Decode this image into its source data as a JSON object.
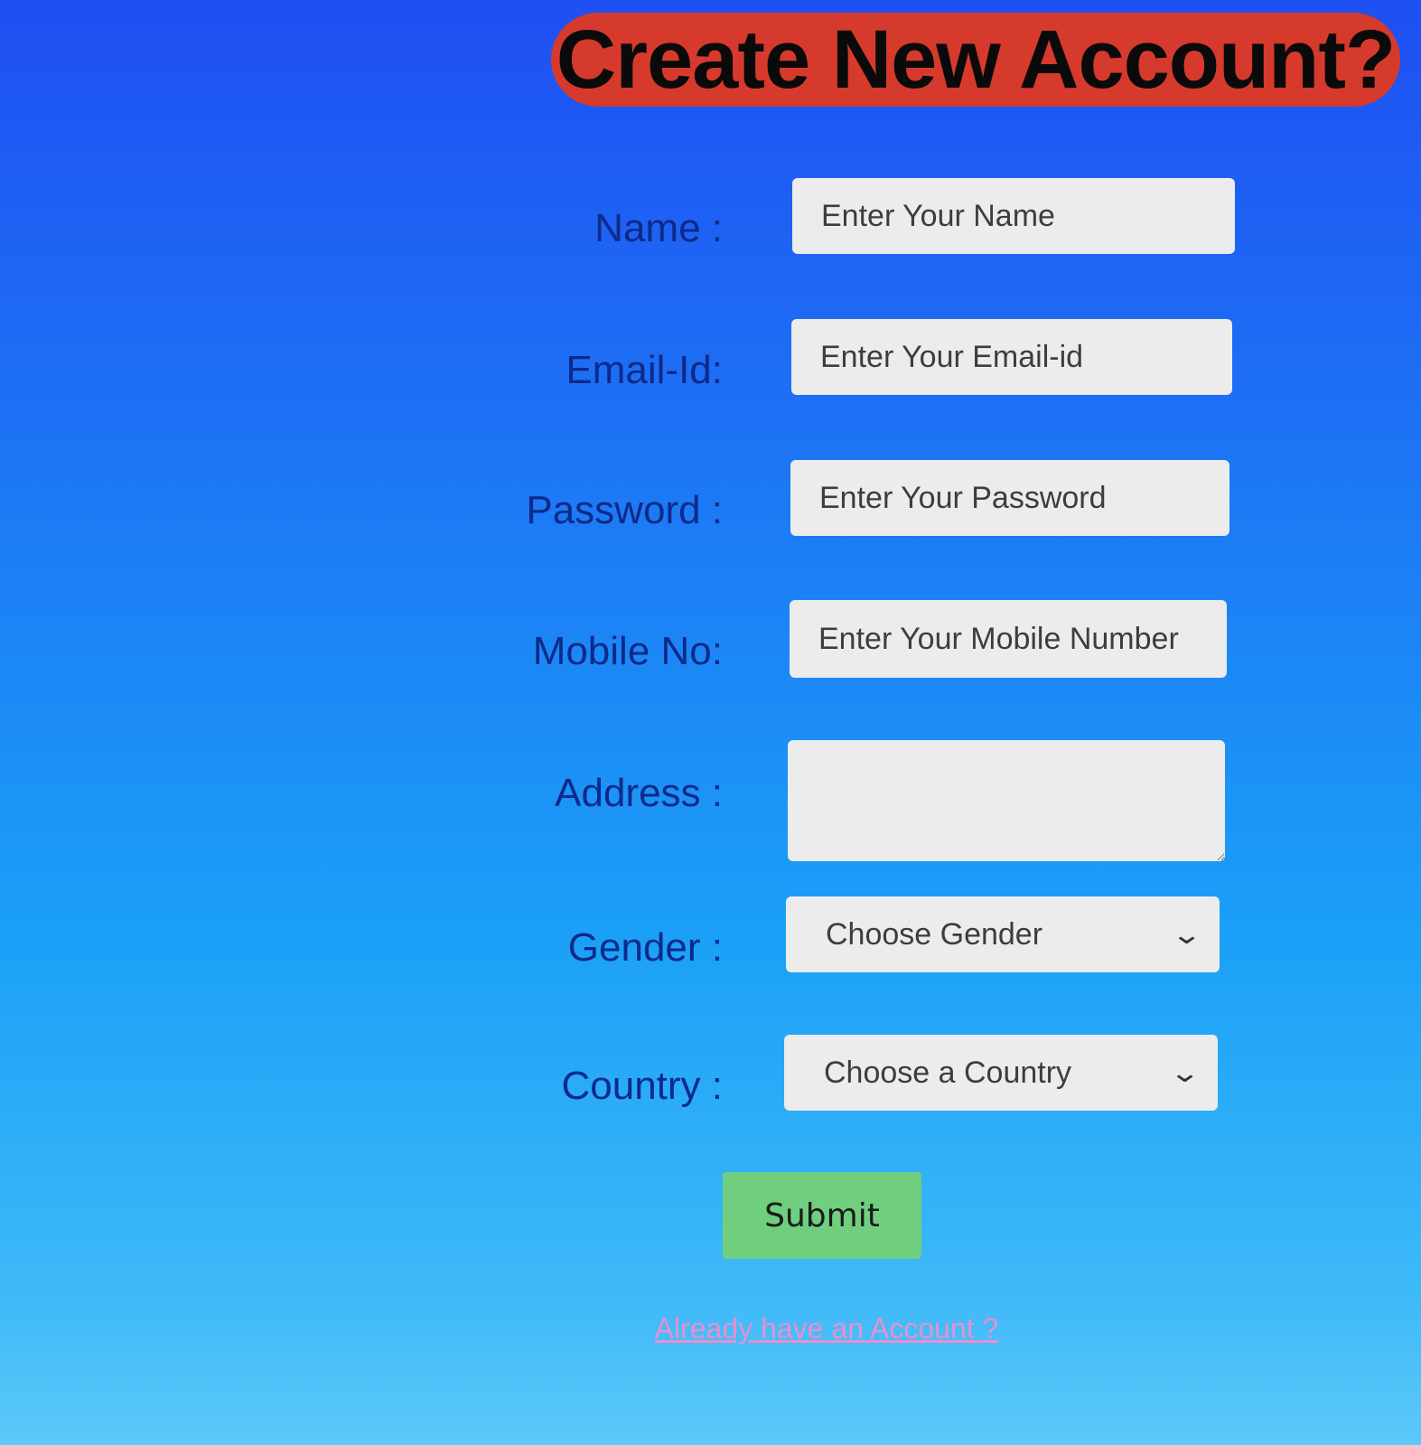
{
  "page": {
    "title": "Create New Account?"
  },
  "form": {
    "name": {
      "label": "Name :",
      "placeholder": "Enter Your Name"
    },
    "email": {
      "label": "Email-Id:",
      "placeholder": "Enter Your Email-id"
    },
    "password": {
      "label": "Password :",
      "placeholder": "Enter Your Password"
    },
    "mobile": {
      "label": "Mobile No:",
      "placeholder": "Enter Your Mobile Number"
    },
    "address": {
      "label": "Address :",
      "placeholder": ""
    },
    "gender": {
      "label": "Gender :",
      "selected": "Choose Gender"
    },
    "country": {
      "label": "Country :",
      "selected": "Choose a Country"
    },
    "submit_label": "Submit",
    "login_link": "Already have an Account ?"
  },
  "icons": {
    "dropdown": "chevron-down-icon"
  },
  "colors": {
    "title_bg": "#d63a2c",
    "submit_bg": "#6fcf7f",
    "link": "#e88fcf",
    "label": "#0d2a8a"
  }
}
